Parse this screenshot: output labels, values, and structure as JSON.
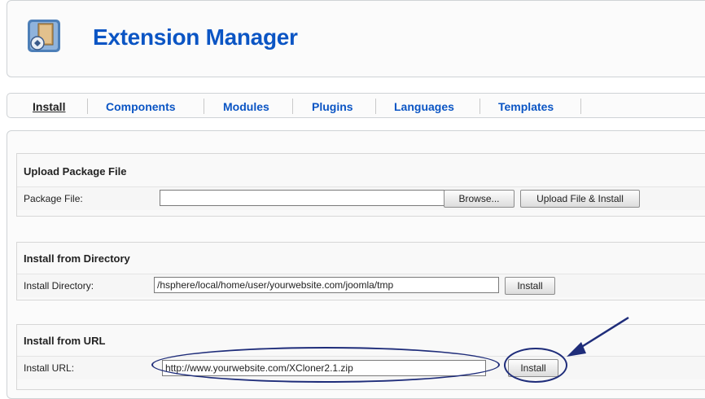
{
  "header": {
    "title": "Extension Manager",
    "icon": "extension-manager-icon"
  },
  "tabs": [
    {
      "label": "Install",
      "active": true
    },
    {
      "label": "Components",
      "active": false
    },
    {
      "label": "Modules",
      "active": false
    },
    {
      "label": "Plugins",
      "active": false
    },
    {
      "label": "Languages",
      "active": false
    },
    {
      "label": "Templates",
      "active": false
    }
  ],
  "upload": {
    "title": "Upload Package File",
    "label": "Package File:",
    "value": "",
    "browse_label": "Browse...",
    "submit_label": "Upload File & Install"
  },
  "directory": {
    "title": "Install from Directory",
    "label": "Install Directory:",
    "value": "/hsphere/local/home/user/yourwebsite.com/joomla/tmp",
    "submit_label": "Install"
  },
  "url": {
    "title": "Install from URL",
    "label": "Install URL:",
    "value": "http://www.yourwebsite.com/XCloner2.1.zip",
    "submit_label": "Install"
  },
  "colors": {
    "link": "#0b55c4",
    "annotation": "#1f2d7a"
  }
}
